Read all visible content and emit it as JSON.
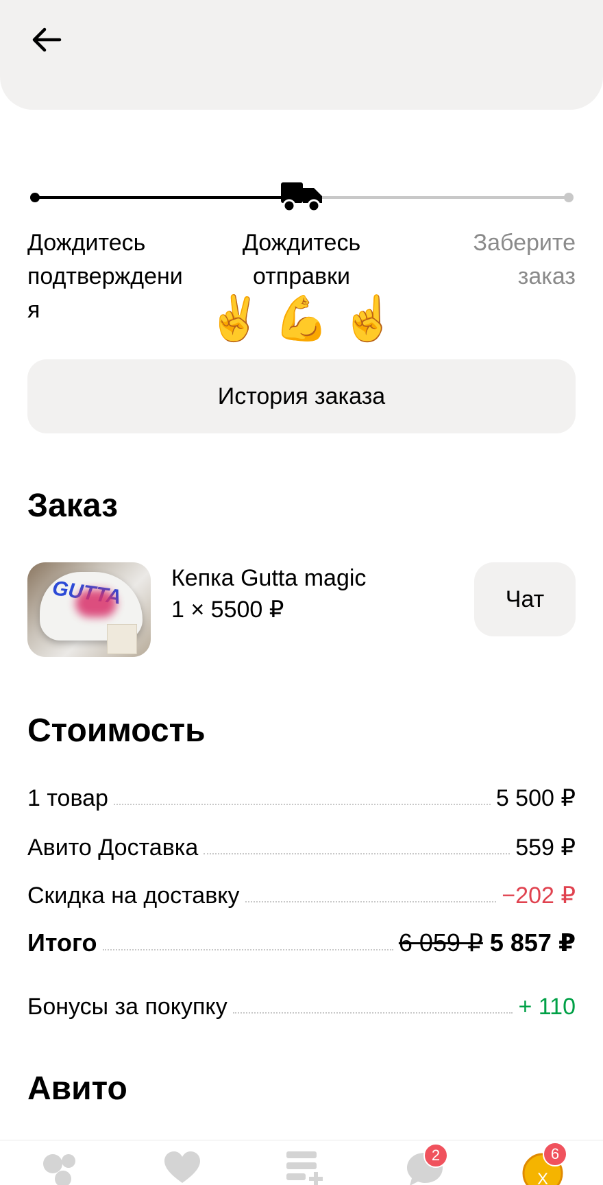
{
  "progress": {
    "steps": [
      {
        "label_line1": "Дождитесь",
        "label_line2": "подтверждени",
        "label_line3": "я"
      },
      {
        "label_line1": "Дождитесь",
        "label_line2": "отправки"
      },
      {
        "label_line1": "Заберите",
        "label_line2": "заказ"
      }
    ],
    "emojis": [
      "✌️",
      "💪",
      "☝️"
    ],
    "colors": {
      "done": "#000000",
      "pending": "#c8c8c8"
    }
  },
  "history_button": "История заказа",
  "order": {
    "title": "Заказ",
    "product": {
      "name": "Кепка Gutta magic",
      "qty_price": "1 × 5500 ₽",
      "image_text": "GUTTA"
    },
    "chat_button": "Чат"
  },
  "cost": {
    "title": "Стоимость",
    "rows": [
      {
        "label": "1 товар",
        "value": "5 500 ₽"
      },
      {
        "label": "Авито Доставка",
        "value": "559 ₽"
      },
      {
        "label": "Скидка на доставку",
        "value": "−202 ₽"
      },
      {
        "label": "Итого",
        "old_value": "6 059 ₽",
        "value": "5 857 ₽"
      }
    ],
    "bonus": {
      "label": "Бонусы за покупку",
      "value": "+ 110"
    },
    "colors": {
      "discount": "#e0424f",
      "bonus": "#00a046"
    }
  },
  "avito_section": {
    "title": "Авито"
  },
  "bottom_nav": {
    "items": [
      {
        "icon": "circles-icon"
      },
      {
        "icon": "heart-icon"
      },
      {
        "icon": "add-listing-icon"
      },
      {
        "icon": "messages-icon",
        "badge": "2"
      },
      {
        "icon": "profile-icon",
        "badge": "6",
        "avatar_text": "Х"
      }
    ]
  }
}
